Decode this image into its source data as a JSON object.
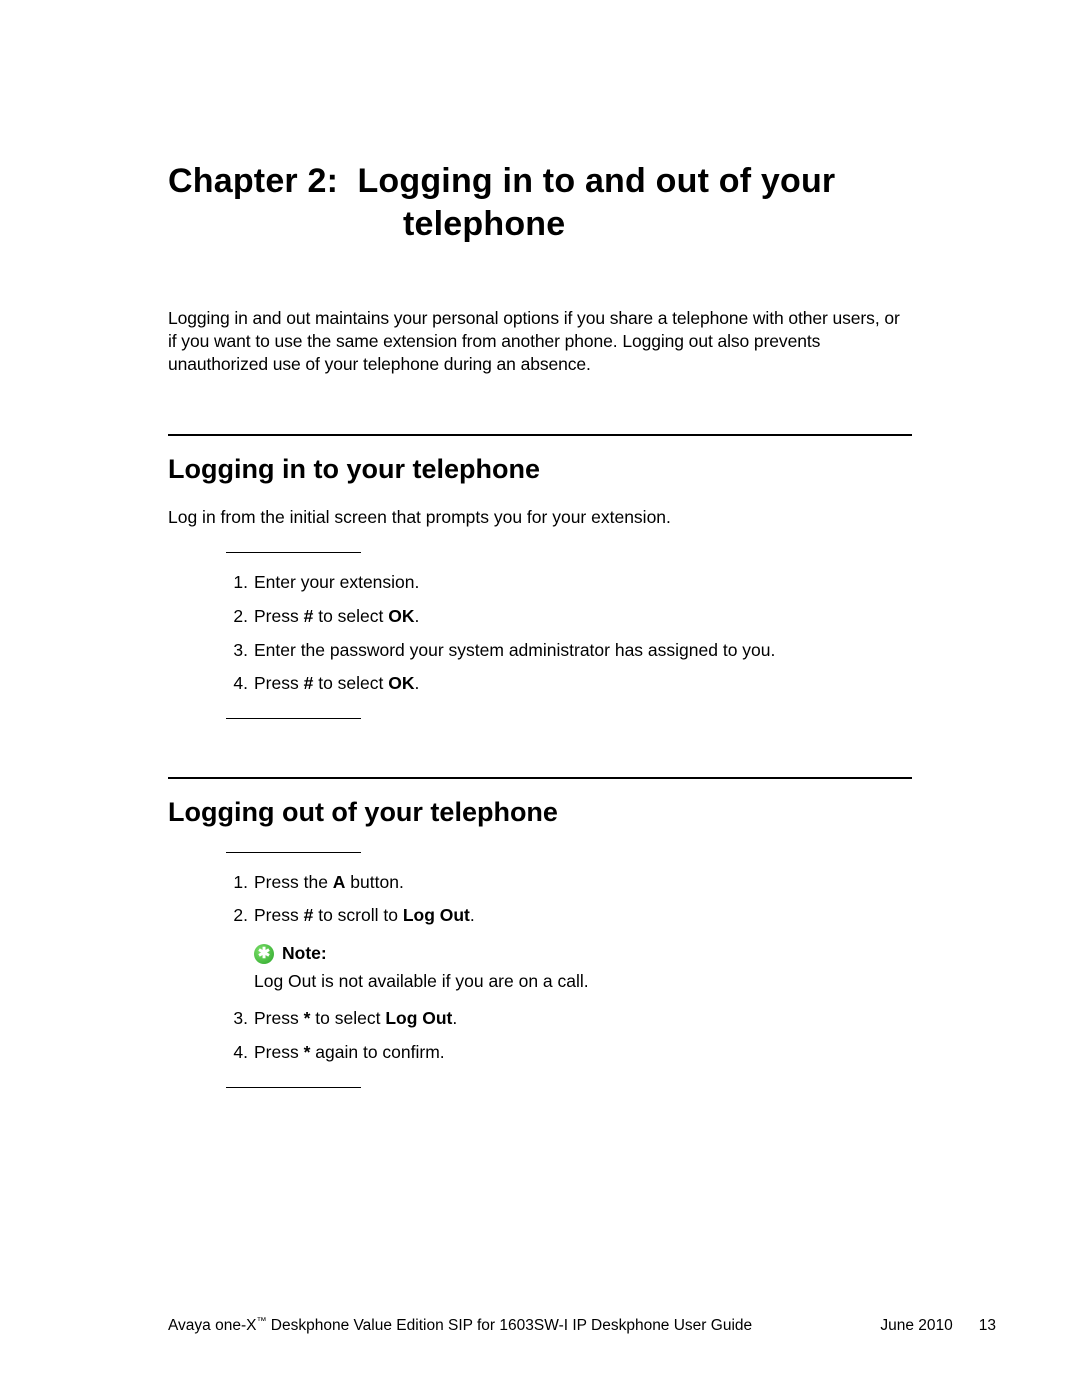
{
  "chapter": {
    "prefix": "Chapter 2:",
    "title_line1": "Logging in to and out of your",
    "title_line2": "telephone"
  },
  "intro": "Logging in and out maintains your personal options if you share a telephone with other users, or if you want to use the same extension from another phone. Logging out also prevents unauthorized use of your telephone during an absence.",
  "section1": {
    "title": "Logging in to your telephone",
    "intro": "Log in from the initial screen that prompts you for your extension.",
    "steps": [
      {
        "n": "1.",
        "pre": "Enter your extension."
      },
      {
        "n": "2.",
        "pre": "Press ",
        "b1": "#",
        "mid": " to select ",
        "b2": "OK",
        "post": "."
      },
      {
        "n": "3.",
        "pre": "Enter the password your system administrator has assigned to you."
      },
      {
        "n": "4.",
        "pre": "Press ",
        "b1": "#",
        "mid": " to select ",
        "b2": "OK",
        "post": "."
      }
    ]
  },
  "section2": {
    "title": "Logging out of your telephone",
    "steps12": [
      {
        "n": "1.",
        "pre": "Press the ",
        "b1": "A",
        "post": " button."
      },
      {
        "n": "2.",
        "pre": "Press ",
        "b1": "#",
        "mid": " to scroll to ",
        "b2": "Log Out",
        "post": "."
      }
    ],
    "note": {
      "label": "Note:",
      "body": "Log Out is not available if you are on a call."
    },
    "steps34": [
      {
        "n": "3.",
        "pre": "Press ",
        "b1": "*",
        "mid": " to select ",
        "b2": "Log Out",
        "post": "."
      },
      {
        "n": "4.",
        "pre": "Press ",
        "b1": "*",
        "post": " again to confirm."
      }
    ]
  },
  "footer": {
    "product_prefix": "Avaya one-X",
    "tm": "™",
    "product_suffix": " Deskphone Value Edition SIP for 1603SW-I IP Deskphone User Guide",
    "date": "June 2010",
    "page": "13"
  }
}
